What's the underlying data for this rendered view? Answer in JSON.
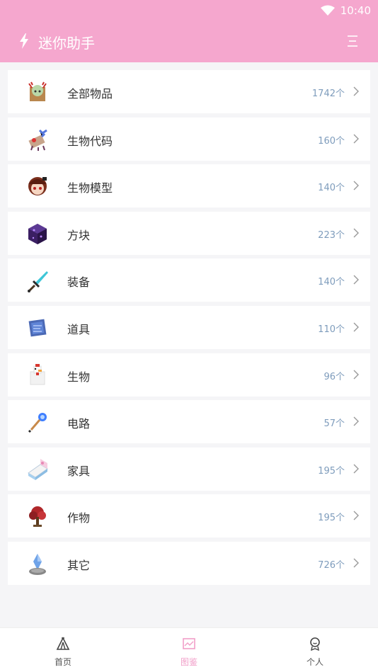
{
  "status_bar": {
    "time": "10:40"
  },
  "header": {
    "title": "迷你助手",
    "menu_icon": "menu-icon",
    "logo_icon": "bolt-icon"
  },
  "categories": [
    {
      "label": "全部物品",
      "count": "1742个",
      "icon": "all-items-icon"
    },
    {
      "label": "生物代码",
      "count": "160个",
      "icon": "creature-code-icon"
    },
    {
      "label": "生物模型",
      "count": "140个",
      "icon": "creature-model-icon"
    },
    {
      "label": "方块",
      "count": "223个",
      "icon": "block-icon"
    },
    {
      "label": "装备",
      "count": "140个",
      "icon": "sword-icon"
    },
    {
      "label": "道具",
      "count": "110个",
      "icon": "scroll-icon"
    },
    {
      "label": "生物",
      "count": "96个",
      "icon": "chicken-icon"
    },
    {
      "label": "电路",
      "count": "57个",
      "icon": "wand-icon"
    },
    {
      "label": "家具",
      "count": "195个",
      "icon": "bed-icon"
    },
    {
      "label": "作物",
      "count": "195个",
      "icon": "tree-icon"
    },
    {
      "label": "其它",
      "count": "726个",
      "icon": "crystal-icon"
    }
  ],
  "bottom_nav": [
    {
      "label": "首页",
      "icon": "tent-icon",
      "active": false
    },
    {
      "label": "图鉴",
      "icon": "picture-icon",
      "active": true
    },
    {
      "label": "个人",
      "icon": "profile-icon",
      "active": false
    }
  ],
  "colors": {
    "header": "#f5a7ce",
    "count_text": "#7e9cbc",
    "active_tab": "#f19ec8"
  }
}
